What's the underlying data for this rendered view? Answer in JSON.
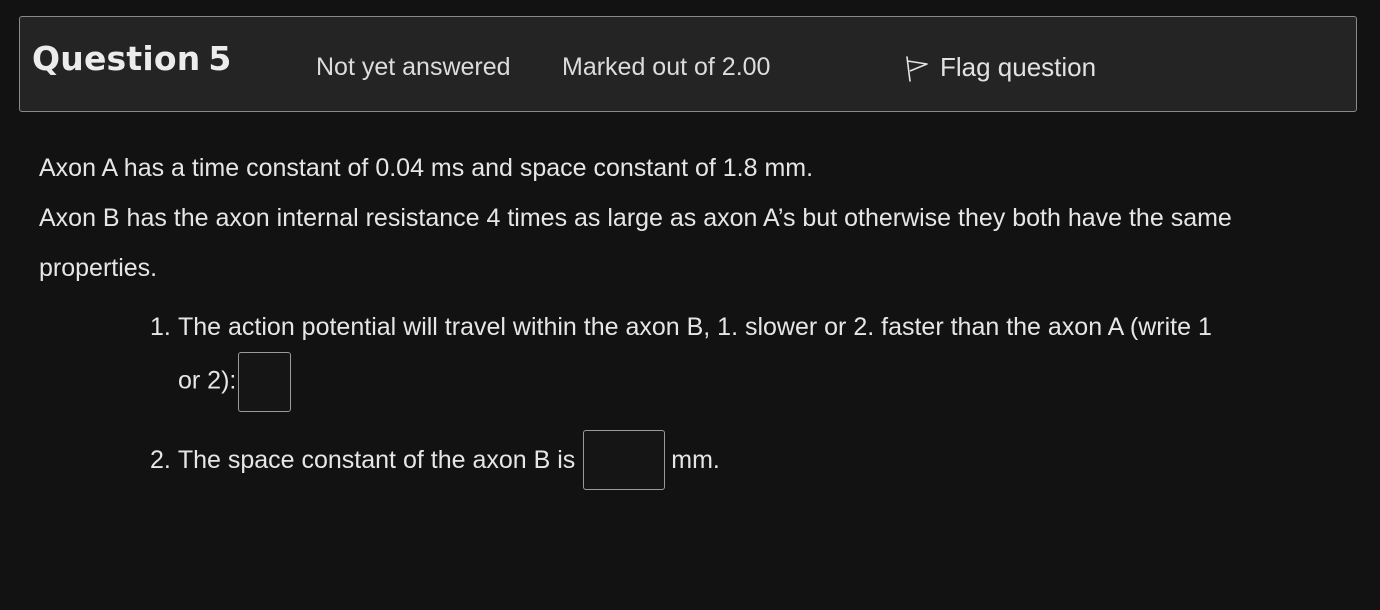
{
  "info": {
    "question_label": "Question",
    "question_number": "5",
    "state": "Not yet answered",
    "grade": "Marked out of 2.00",
    "flag_label": "Flag question",
    "flag_icon": "flag-outline-icon"
  },
  "question": {
    "paragraph1": "Axon A has a time constant of 0.04 ms and space constant of 1.8 mm.",
    "paragraph2": "Axon B has the axon internal resistance 4 times as large as axon A’s but otherwise they both have the same properties.",
    "sub1": {
      "number": "1.",
      "line1": "The action potential will travel within the axon B, 1. slower or 2. faster than the axon A (write 1",
      "line2": "or 2):",
      "answer_value": ""
    },
    "sub2": {
      "number": "2.",
      "text_before": "The space constant of the axon B is",
      "answer_value": "",
      "unit": "mm."
    }
  }
}
